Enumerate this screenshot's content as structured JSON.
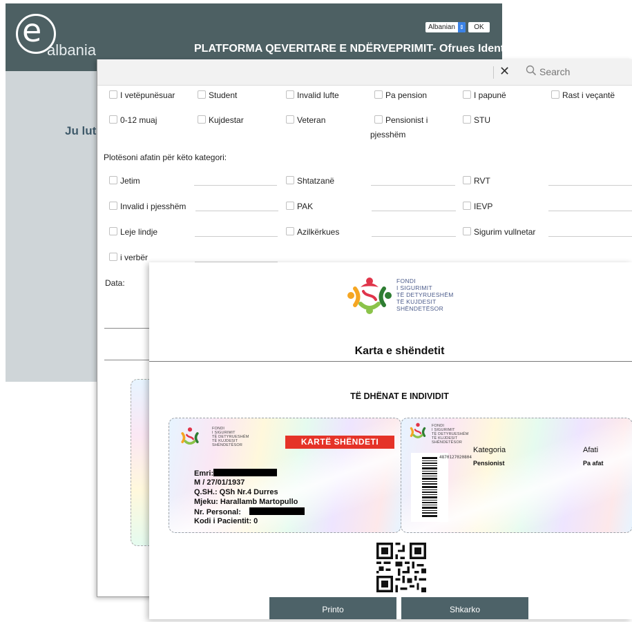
{
  "portal": {
    "logo_letter": "e",
    "logo_word": "albania",
    "language": "Albanian",
    "ok_label": "OK",
    "title": "PLATFORMA QEVERITARE E NDËRVEPRIMIT- Ofrues Identiteti",
    "prompt_partial": "Ju lutem"
  },
  "searchbar": {
    "clear_icon": "close-icon",
    "placeholder": "Search"
  },
  "form": {
    "checkboxes_row1": [
      "I vetëpunësuar",
      "Student",
      "Invalid lufte",
      "Pa pension",
      "I papunë",
      "Rast i veçantë"
    ],
    "checkboxes_row2": [
      "0-12 muaj",
      "Kujdestar",
      "Veteran",
      "Pensionist i",
      "STU"
    ],
    "row2_wrap": "pjesshëm",
    "deadline_prompt": "Plotësoni afatin për këto kategori:",
    "deadline_categories": [
      "Jetim",
      "Shtatzanë",
      "RVT",
      "Invalid i pjesshëm",
      "PAK",
      "IEVP",
      "Leje lindje",
      "Azilkërkues",
      "Sigurim vullnetar",
      "i verbër"
    ],
    "data_label": "Data:"
  },
  "card": {
    "fund_name": [
      "FONDI",
      "I SIGURIMIT",
      "TË DETYRUESHËM",
      "TË KUJDESIT",
      "SHËNDETËSOR"
    ],
    "title": "Karta e shëndetit",
    "section_title": "TË DHËNAT E INDIVIDIT",
    "badge": "KARTË SHËNDETI",
    "emri_label": "Emri:",
    "gender_dob": "M  /  27/01/1937",
    "qsh": "Q.SH.:  QSh Nr.4 Durres",
    "doctor": "Mjeku:  Harallamb Martopullo",
    "personal_label": "Nr. Personal:",
    "patient_code": "Kodi i Pacientit:  0",
    "barcode_number": "4870127020804",
    "category_label": "Kategoria",
    "category_value": "Pensionist",
    "deadline_label": "Afati",
    "deadline_value": "Pa afat",
    "print_label": "Printo",
    "download_label": "Shkarko"
  },
  "colors": {
    "header": "#4d6063",
    "portal_bg": "#cfd5d8",
    "badge_red": "#e53328",
    "button": "#4d6268"
  }
}
